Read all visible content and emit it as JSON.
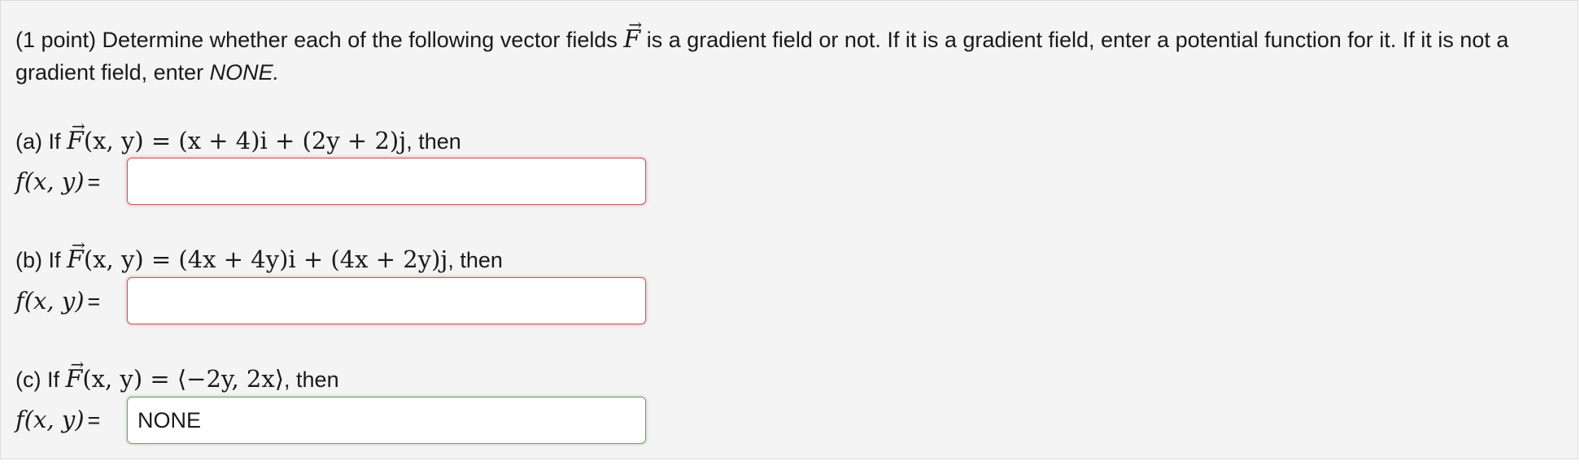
{
  "problem": {
    "intro_part1": "(1 point) Determine whether each of the following vector fields ",
    "intro_vector_symbol": "F",
    "intro_part2": " is a gradient field or not. If it is a gradient field, enter a potential function for it. If it is not a gradient field, enter ",
    "intro_none": "NONE."
  },
  "parts": [
    {
      "label": "(a) If ",
      "field_symbol": "F",
      "math": "(x, y) = (x + 4)i + (2y + 2)j",
      "suffix": ", then",
      "f_label": "f(x, y)",
      "equals": "=",
      "answer": "",
      "status": "incorrect"
    },
    {
      "label": "(b) If ",
      "field_symbol": "F",
      "math": "(x, y) = (4x + 4y)i + (4x + 2y)j",
      "suffix": ", then",
      "f_label": "f(x, y)",
      "equals": "=",
      "answer": "",
      "status": "incorrect"
    },
    {
      "label": "(c) If ",
      "field_symbol": "F",
      "math": "(x, y) = ⟨−2y, 2x⟩",
      "suffix": ", then",
      "f_label": "f(x, y)",
      "equals": "=",
      "answer": "NONE",
      "status": "correct"
    }
  ],
  "colors": {
    "incorrect_border": "#c9585b",
    "correct_border": "#6aa764",
    "panel_bg": "#f4f4f4"
  }
}
